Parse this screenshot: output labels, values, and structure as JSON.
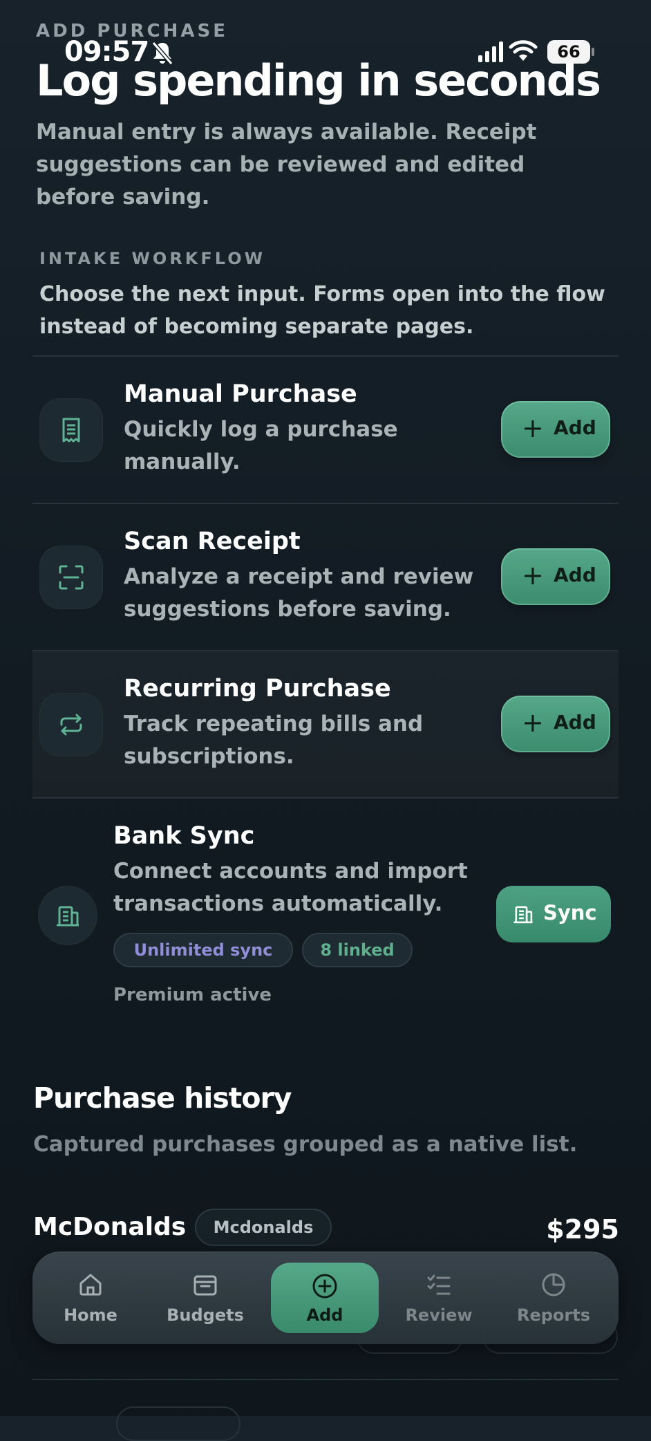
{
  "status_bar": {
    "time": "09:57",
    "battery": "66"
  },
  "header": {
    "eyebrow": "ADD PURCHASE",
    "title": "Log spending in seconds",
    "subtitle": "Manual entry is always available. Receipt suggestions can be reviewed and edited before saving."
  },
  "workflow": {
    "eyebrow": "INTAKE WORKFLOW",
    "description": "Choose the next input. Forms open into the flow instead of becoming separate pages.",
    "items": [
      {
        "title": "Manual Purchase",
        "description": "Quickly log a purchase manually.",
        "action": "Add",
        "icon": "receipt-icon"
      },
      {
        "title": "Scan Receipt",
        "description": "Analyze a receipt and review suggestions before saving.",
        "action": "Add",
        "icon": "scan-icon"
      },
      {
        "title": "Recurring Purchase",
        "description": "Track repeating bills and subscriptions.",
        "action": "Add",
        "icon": "repeat-icon"
      }
    ],
    "bank_sync": {
      "title": "Bank Sync",
      "description": "Connect accounts and import transactions automatically.",
      "action": "Sync",
      "badges": [
        "Unlimited sync",
        "8 linked"
      ],
      "note": "Premium active",
      "icon": "bank-icon"
    }
  },
  "history": {
    "title": "Purchase history",
    "subtitle": "Captured purchases grouped as a native list.",
    "items": [
      {
        "merchant": "McDonalds",
        "tag": "Mcdonalds",
        "amount": "$295"
      }
    ]
  },
  "nav": {
    "items": [
      {
        "label": "Home",
        "icon": "home-icon"
      },
      {
        "label": "Budgets",
        "icon": "wallet-icon"
      },
      {
        "label": "Add",
        "icon": "plus-circle-icon",
        "active": true
      },
      {
        "label": "Review",
        "icon": "checklist-icon"
      },
      {
        "label": "Reports",
        "icon": "pie-chart-icon"
      }
    ]
  },
  "colors": {
    "accent": "#4e9f80",
    "background": "#141e25",
    "badge_purple": "#8f8ed6",
    "badge_green": "#5fae8c"
  }
}
